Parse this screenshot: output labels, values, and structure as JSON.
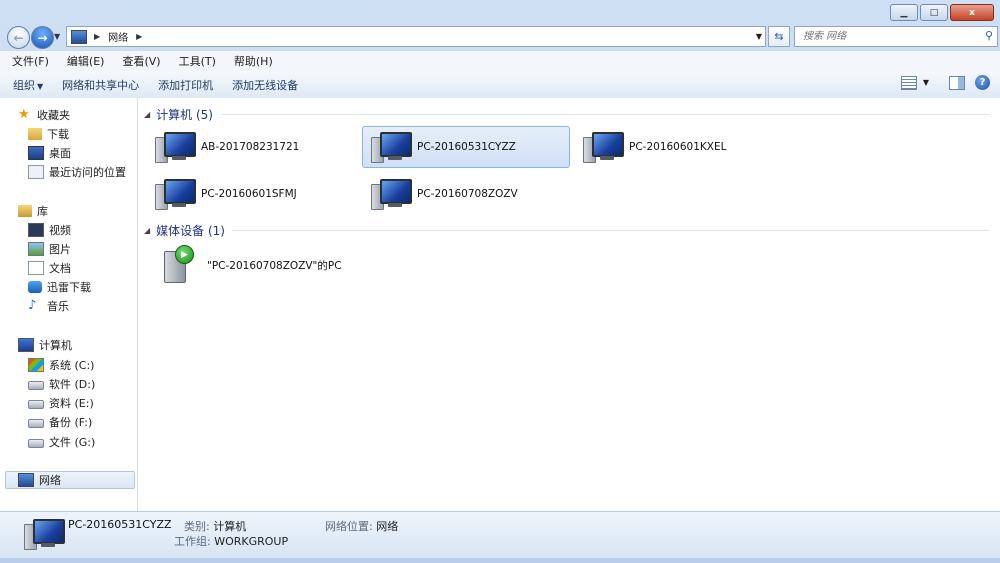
{
  "window": {
    "caption_buttons": [
      "minimize",
      "maximize",
      "close"
    ],
    "close_glyph": "x"
  },
  "address": {
    "crumbs": [
      "网络"
    ],
    "search_placeholder": "搜索 网络"
  },
  "menu": [
    "文件(F)",
    "编辑(E)",
    "查看(V)",
    "工具(T)",
    "帮助(H)"
  ],
  "commands": {
    "organize": "组织",
    "network_center": "网络和共享中心",
    "add_printer": "添加打印机",
    "add_wireless": "添加无线设备"
  },
  "nav": {
    "favorites": "收藏夹",
    "downloads": "下载",
    "desktop": "桌面",
    "recent": "最近访问的位置",
    "libraries": "库",
    "videos": "视频",
    "pictures": "图片",
    "documents": "文档",
    "thunder": "迅雷下载",
    "music": "音乐",
    "computer": "计算机",
    "drives": [
      {
        "label": "系统 (C:)"
      },
      {
        "label": "软件 (D:)"
      },
      {
        "label": "资料 (E:)"
      },
      {
        "label": "备份 (F:)"
      },
      {
        "label": "文件 (G:)"
      }
    ],
    "network": "网络"
  },
  "groups": {
    "computers": {
      "header": "计算机 (5)",
      "items": [
        "AB-201708231721",
        "PC-20160531CYZZ",
        "PC-20160601KXEL",
        "PC-20160601SFMJ",
        "PC-20160708ZOZV"
      ],
      "selected_index": 1
    },
    "media": {
      "header": "媒体设备 (1)",
      "items": [
        "\"PC-20160708ZOZV\"的PC"
      ]
    }
  },
  "details": {
    "name": "PC-20160531CYZZ",
    "category_label": "类别:",
    "category": "计算机",
    "workgroup_label": "工作组:",
    "workgroup": "WORKGROUP",
    "location_label": "网络位置:",
    "location": "网络"
  },
  "icons": {
    "back": "back-arrow-icon",
    "forward": "forward-arrow-icon",
    "refresh": "refresh-icon",
    "search": "magnifier-icon",
    "help": "help-icon"
  }
}
